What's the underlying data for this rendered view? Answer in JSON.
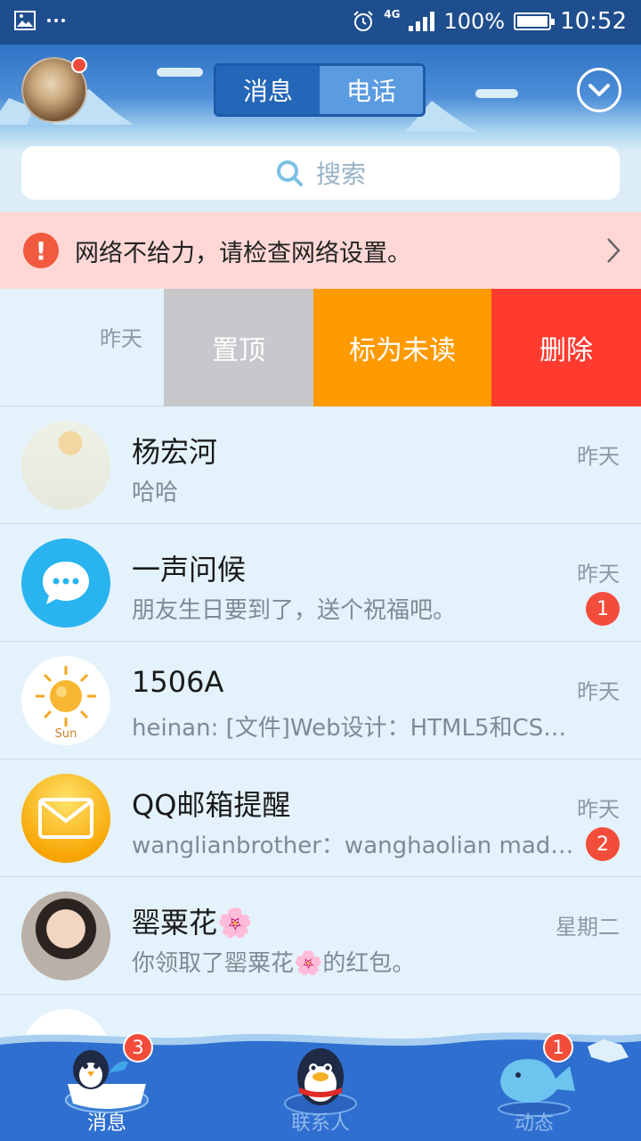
{
  "status_bar": {
    "network": "4G",
    "battery": "100%",
    "time": "10:52",
    "icons": [
      "image-icon",
      "more-icon",
      "alarm-icon",
      "signal-icon",
      "battery-icon"
    ]
  },
  "header": {
    "tabs": [
      {
        "label": "消息",
        "active": true
      },
      {
        "label": "电话",
        "active": false
      }
    ],
    "search_placeholder": "搜索",
    "avatar_has_notification": true
  },
  "network_banner": {
    "text": "网络不给力，请检查网络设置。",
    "icon": "warning-icon",
    "color": "#ffd8d6"
  },
  "swiped_row": {
    "time": "昨天",
    "actions": [
      {
        "label": "置顶",
        "color": "#c7c7cc"
      },
      {
        "label": "标为未读",
        "color": "#ff9a00"
      },
      {
        "label": "删除",
        "color": "#ff3b30"
      }
    ]
  },
  "conversations": [
    {
      "name": "杨宏河",
      "message": "哈哈",
      "time": "昨天",
      "badge": ""
    },
    {
      "name": "一声问候",
      "message": "朋友生日要到了，送个祝福吧。",
      "time": "昨天",
      "badge": "1"
    },
    {
      "name": "1506A",
      "message": "heinan: [文件]Web设计：HTML5和CSS3…",
      "time": "昨天",
      "badge": ""
    },
    {
      "name": "QQ邮箱提醒",
      "message": "wanglianbrother：wanghaolian mad…",
      "time": "昨天",
      "badge": "2"
    },
    {
      "name": "罂粟花🌸",
      "message": "你领取了罂粟花🌸的红包。",
      "time": "星期二",
      "badge": ""
    }
  ],
  "tabbar": {
    "tabs": [
      {
        "label": "消息",
        "badge": "3",
        "active": true
      },
      {
        "label": "联系人",
        "badge": "",
        "active": false
      },
      {
        "label": "动态",
        "badge": "1",
        "active": false
      }
    ],
    "sun_avatar_text": "Sun"
  },
  "colors": {
    "header_blue": "#2f73c6",
    "tabbar_blue": "#2f6fd0",
    "badge_red": "#f24d3a",
    "list_bg": "#e4f2fb"
  }
}
